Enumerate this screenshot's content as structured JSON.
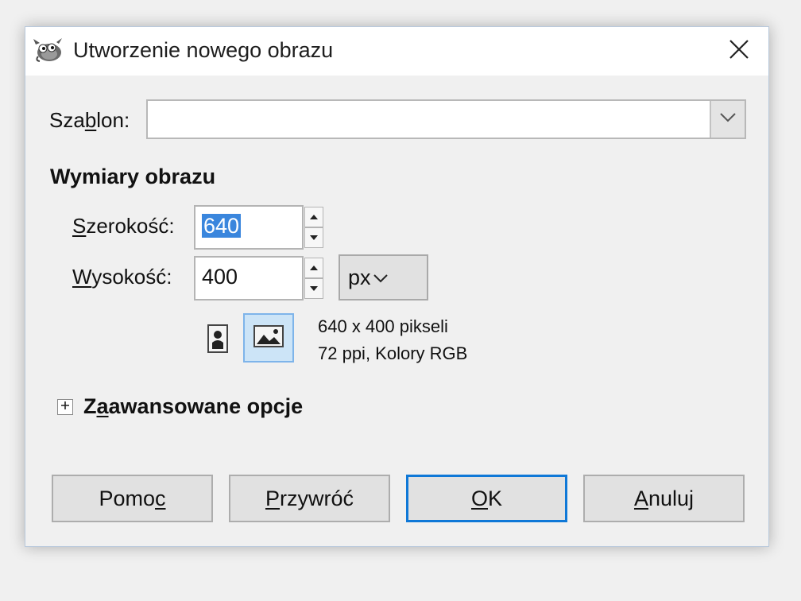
{
  "window": {
    "title": "Utworzenie nowego obrazu",
    "app_icon": "gimp-wilber-icon",
    "close_icon": "close-icon"
  },
  "template": {
    "label_pre": "Sza",
    "label_mnemonic": "b",
    "label_post": "lon:",
    "value": "",
    "dropdown_icon": "chevron-down-icon"
  },
  "dimensions": {
    "heading": "Wymiary obrazu",
    "width": {
      "label_mnemonic": "S",
      "label_post": "zerokość:",
      "value": "640",
      "value_selected": true
    },
    "height": {
      "label_mnemonic": "W",
      "label_post": "ysokość:",
      "value": "400"
    },
    "unit": "px",
    "orientation": {
      "portrait_icon": "portrait-orientation-icon",
      "landscape_icon": "landscape-orientation-icon",
      "selected": "landscape"
    },
    "info_line1": "640 x 400 pikseli",
    "info_line2": "72 ppi, Kolory RGB"
  },
  "advanced": {
    "expander_icon": "expand-plus-icon",
    "label_pre": "Z",
    "label_mnemonic": "a",
    "label_post": "awansowane opcje"
  },
  "buttons": {
    "help": {
      "pre": "Pomo",
      "mnemonic": "c",
      "post": ""
    },
    "reset": {
      "pre": "",
      "mnemonic": "P",
      "post": "rzywróć"
    },
    "ok": {
      "pre": "",
      "mnemonic": "O",
      "post": "K"
    },
    "cancel": {
      "pre": "",
      "mnemonic": "A",
      "post": "nuluj"
    }
  },
  "colors": {
    "selection": "#3a86dd",
    "default_button_border": "#0f78d7",
    "toggle_active_bg": "#cce4f7"
  }
}
